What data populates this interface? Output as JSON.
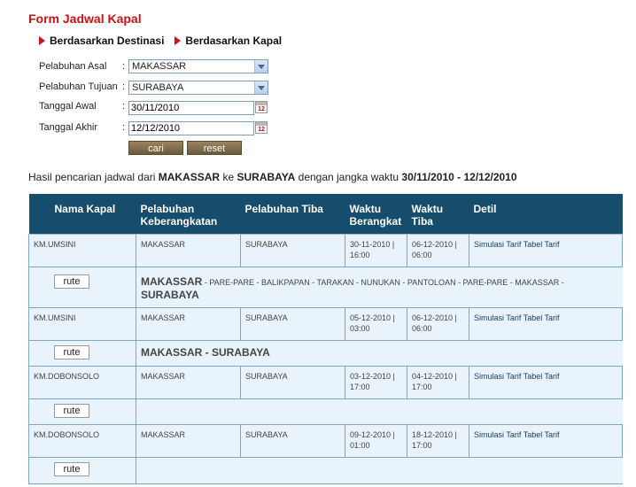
{
  "form": {
    "title": "Form Jadwal Kapal",
    "tabs": [
      "Berdasarkan Destinasi",
      "Berdasarkan Kapal"
    ],
    "asal_label": "Pelabuhan Asal",
    "tujuan_label": "Pelabuhan Tujuan",
    "awal_label": "Tanggal Awal",
    "akhir_label": "Tanggal Akhir",
    "colon": ":",
    "asal_value": "MAKASSAR",
    "tujuan_value": "SURABAYA",
    "awal_value": "30/11/2010",
    "akhir_value": "12/12/2010",
    "calendar_day": "12",
    "cari_label": "cari",
    "reset_label": "reset"
  },
  "summary": {
    "prefix": "Hasil pencarian jadwal dari",
    "from": "MAKASSAR",
    "mid": "ke",
    "to": "SURABAYA",
    "mid2": "dengan jangka waktu",
    "range": "30/11/2010 - 12/12/2010"
  },
  "table": {
    "headers": [
      "Nama Kapal",
      "Pelabuhan Keberangkatan",
      "Pelabuhan Tiba",
      "Waktu Berangkat",
      "Waktu Tiba",
      "Detil"
    ],
    "rute_label": "rute",
    "rows": [
      {
        "kapal": "KM.UMSINI",
        "berangkat_port": "MAKASSAR",
        "tiba_port": "SURABAYA",
        "waktu_berangkat": "30-11-2010 | 16:00",
        "waktu_tiba": "06-12-2010 | 06:00",
        "detil1": "Simulasi Tarif",
        "detil2": "Tabel Tarif",
        "route_start": "MAKASSAR",
        "route_mid": " - PARE-PARE - BALIKPAPAN - TARAKAN - NUNUKAN - PANTOLOAN - PARE-PARE - MAKASSAR - ",
        "route_end": "SURABAYA"
      },
      {
        "kapal": "KM.UMSINI",
        "berangkat_port": "MAKASSAR",
        "tiba_port": "SURABAYA",
        "waktu_berangkat": "05-12-2010 | 03:00",
        "waktu_tiba": "06-12-2010 | 06:00",
        "detil1": "Simulasi Tarif",
        "detil2": "Tabel Tarif",
        "route_full": "MAKASSAR - SURABAYA"
      },
      {
        "kapal": "KM.DOBONSOLO",
        "berangkat_port": "MAKASSAR",
        "tiba_port": "SURABAYA",
        "waktu_berangkat": "03-12-2010 | 17:00",
        "waktu_tiba": "04-12-2010 | 17:00",
        "detil1": "Simulasi Tarif",
        "detil2": "Tabel Tarif"
      },
      {
        "kapal": "KM.DOBONSOLO",
        "berangkat_port": "MAKASSAR",
        "tiba_port": "SURABAYA",
        "waktu_berangkat": "09-12-2010 | 01:00",
        "waktu_tiba": "18-12-2010 | 17:00",
        "detil1": "Simulasi Tarif",
        "detil2": "Tabel Tarif"
      }
    ]
  }
}
